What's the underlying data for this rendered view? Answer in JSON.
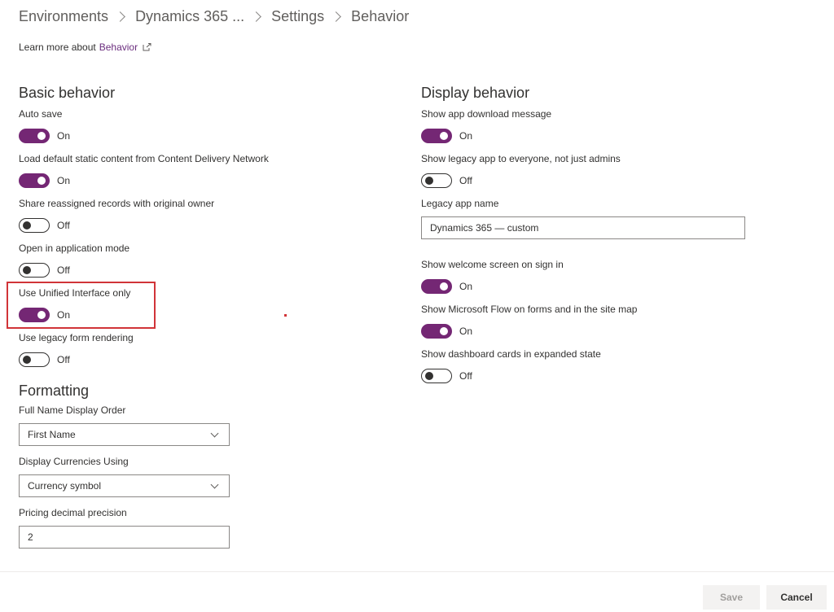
{
  "breadcrumb": [
    {
      "label": "Environments"
    },
    {
      "label": "Dynamics 365 ..."
    },
    {
      "label": "Settings"
    },
    {
      "label": "Behavior"
    }
  ],
  "learn_more": {
    "prefix": "Learn more about",
    "link": "Behavior",
    "icon": "external-link-icon"
  },
  "basic": {
    "title": "Basic behavior",
    "settings": [
      {
        "label": "Auto save",
        "state": "On"
      },
      {
        "label": "Load default static content from Content Delivery Network",
        "state": "On"
      },
      {
        "label": "Share reassigned records with original owner",
        "state": "Off"
      },
      {
        "label": "Open in application mode",
        "state": "Off"
      },
      {
        "label": "Use Unified Interface only",
        "state": "On"
      },
      {
        "label": "Use legacy form rendering",
        "state": "Off"
      }
    ]
  },
  "formatting": {
    "title": "Formatting",
    "name_order": {
      "label": "Full Name Display Order",
      "value": "First Name"
    },
    "currency": {
      "label": "Display Currencies Using",
      "value": "Currency symbol"
    },
    "precision": {
      "label": "Pricing decimal precision",
      "value": "2"
    }
  },
  "display": {
    "title": "Display behavior",
    "download_msg": {
      "label": "Show app download message",
      "state": "On"
    },
    "legacy_everyone": {
      "label": "Show legacy app to everyone, not just admins",
      "state": "Off"
    },
    "legacy_name": {
      "label": "Legacy app name",
      "value": "Dynamics 365 — custom"
    },
    "welcome": {
      "label": "Show welcome screen on sign in",
      "state": "On"
    },
    "flow": {
      "label": "Show Microsoft Flow on forms and in the site map",
      "state": "On"
    },
    "dashboard": {
      "label": "Show dashboard cards in expanded state",
      "state": "Off"
    }
  },
  "footer": {
    "save_label": "Save",
    "cancel_label": "Cancel"
  },
  "colors": {
    "toggle_on": "#742774",
    "highlight": "#d13438",
    "link": "#6b2e7e"
  }
}
